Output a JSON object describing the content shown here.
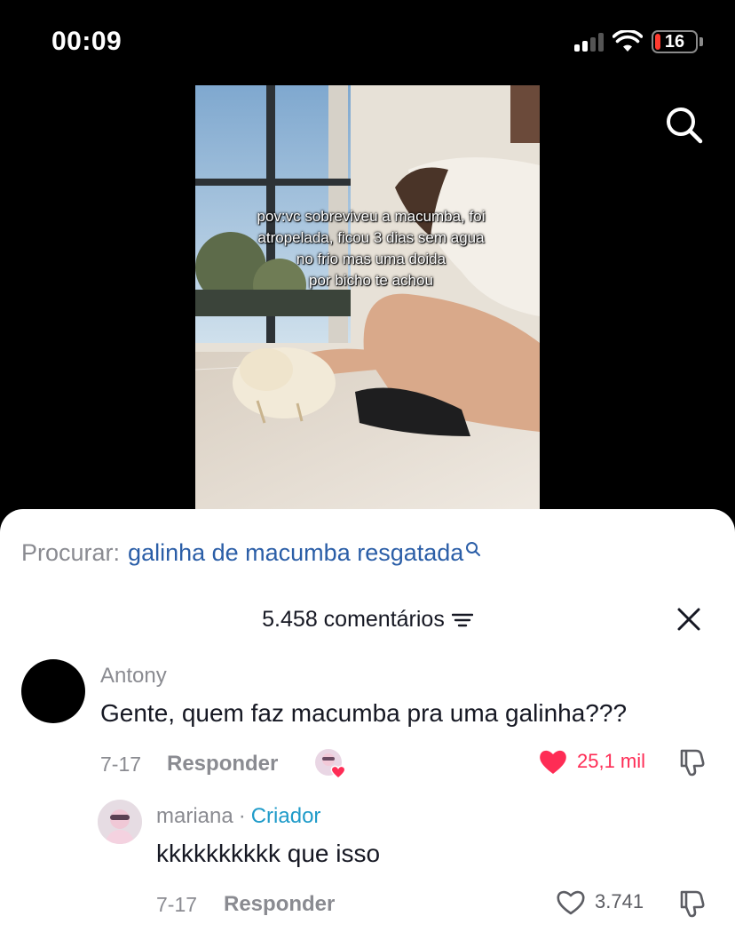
{
  "status_bar": {
    "time": "00:09",
    "battery": "16"
  },
  "video": {
    "caption_lines": [
      "pov:vc sobreviveu a macumba, foi",
      "atropelada, ficou 3 dias sem agua",
      "no frio mas uma doida",
      "por bicho te achou"
    ]
  },
  "search_suggestion": {
    "label": "Procurar:",
    "query": "galinha de macumba resgatada"
  },
  "comments": {
    "count_label": "5.458 comentários",
    "items": [
      {
        "user": "Antony",
        "text": "Gente, quem faz macumba pra uma galinha???",
        "date": "7-17",
        "reply_label": "Responder",
        "likes": "25,1 mil",
        "liked": true,
        "creator_liked": true
      },
      {
        "user": "mariana",
        "separator": "·",
        "badge": "Criador",
        "text": "kkkkkkkkkk que isso",
        "date": "7-17",
        "reply_label": "Responder",
        "likes": "3.741",
        "liked": false
      }
    ]
  },
  "colors": {
    "like_active": "#fe2c55",
    "link": "#2b5ea7",
    "creator_badge": "#1f9bc9",
    "muted": "#8a8b91"
  },
  "icons": [
    "signal-icon",
    "wifi-icon",
    "battery-icon",
    "search-icon",
    "sort-icon",
    "close-icon",
    "heart-icon",
    "dislike-icon"
  ]
}
